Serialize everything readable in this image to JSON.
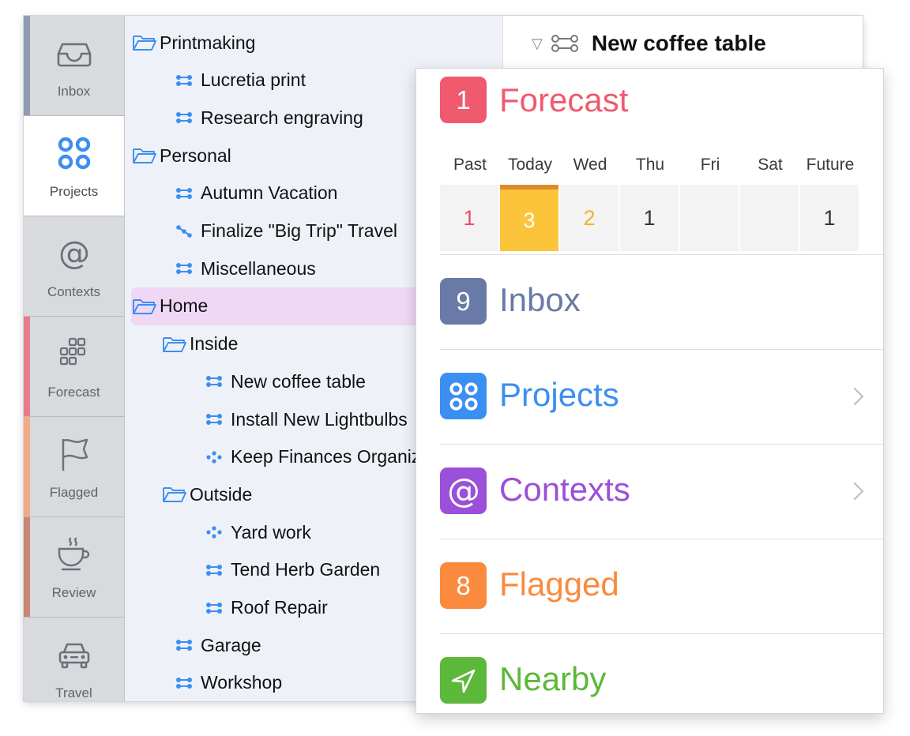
{
  "perspectives": [
    {
      "label": "Inbox",
      "icon": "inbox-tray-icon",
      "stripe": "#8f9bb3",
      "active": false
    },
    {
      "label": "Projects",
      "icon": "projects-circles-icon",
      "stripe": "",
      "active": true
    },
    {
      "label": "Contexts",
      "icon": "at-sign-icon",
      "stripe": "",
      "active": false
    },
    {
      "label": "Forecast",
      "icon": "forecast-grid-icon",
      "stripe": "#e57d8c",
      "active": false
    },
    {
      "label": "Flagged",
      "icon": "flag-icon",
      "stripe": "#f2ab84",
      "active": false
    },
    {
      "label": "Review",
      "icon": "coffee-cup-icon",
      "stripe": "#c98672",
      "active": false
    },
    {
      "label": "Travel",
      "icon": "car-icon",
      "stripe": "",
      "active": false
    }
  ],
  "outline": [
    {
      "text": "Printmaking",
      "type": "folder",
      "level": 0
    },
    {
      "text": "Lucretia print",
      "type": "parallel",
      "level": 1
    },
    {
      "text": "Research engraving",
      "type": "parallel",
      "level": 1
    },
    {
      "text": "Personal",
      "type": "folder",
      "level": 0
    },
    {
      "text": "Autumn Vacation",
      "type": "parallel",
      "level": 1
    },
    {
      "text": "Finalize \"Big Trip\" Travel",
      "type": "sequential",
      "level": 1
    },
    {
      "text": "Miscellaneous",
      "type": "parallel",
      "level": 1
    },
    {
      "text": "Home",
      "type": "folder",
      "level": 0,
      "selected": true
    },
    {
      "text": "Inside",
      "type": "folder",
      "level": 1
    },
    {
      "text": "New coffee table",
      "type": "parallel",
      "level": 2
    },
    {
      "text": "Install New Lightbulbs",
      "type": "parallel",
      "level": 2
    },
    {
      "text": "Keep Finances Organized",
      "type": "single",
      "level": 2
    },
    {
      "text": "Outside",
      "type": "folder",
      "level": 1
    },
    {
      "text": "Yard work",
      "type": "single",
      "level": 2
    },
    {
      "text": "Tend Herb Garden",
      "type": "parallel",
      "level": 2
    },
    {
      "text": "Roof Repair",
      "type": "parallel",
      "level": 2
    },
    {
      "text": "Garage",
      "type": "parallel",
      "level": 1
    },
    {
      "text": "Workshop",
      "type": "parallel",
      "level": 1
    }
  ],
  "detail": {
    "title": "New coffee table"
  },
  "popover": {
    "forecast": {
      "count": "1",
      "label": "Forecast",
      "color": "#f05a6e",
      "days": [
        "Past",
        "Today",
        "Wed",
        "Thu",
        "Fri",
        "Sat",
        "Future"
      ],
      "counts": [
        "1",
        "3",
        "2",
        "1",
        "",
        "",
        "1"
      ],
      "count_colors": [
        "#e8505e",
        "#ffffff",
        "#f6b223",
        "#333333",
        "#333333",
        "#333333",
        "#333333"
      ]
    },
    "rows": [
      {
        "count": "9",
        "label": "Inbox",
        "color": "#6a7aa6",
        "badge_icon": "",
        "chevron": false
      },
      {
        "count": "",
        "label": "Projects",
        "color": "#3b8ff0",
        "badge_icon": "projects-circles-icon",
        "chevron": true
      },
      {
        "count": "",
        "label": "Contexts",
        "color": "#9a50d8",
        "badge_icon": "at-sign-icon",
        "chevron": true
      },
      {
        "count": "8",
        "label": "Flagged",
        "color": "#fa8a3e",
        "badge_icon": "",
        "chevron": false
      },
      {
        "count": "",
        "label": "Nearby",
        "color": "#5cb83a",
        "badge_icon": "location-arrow-icon",
        "chevron": false
      }
    ]
  }
}
